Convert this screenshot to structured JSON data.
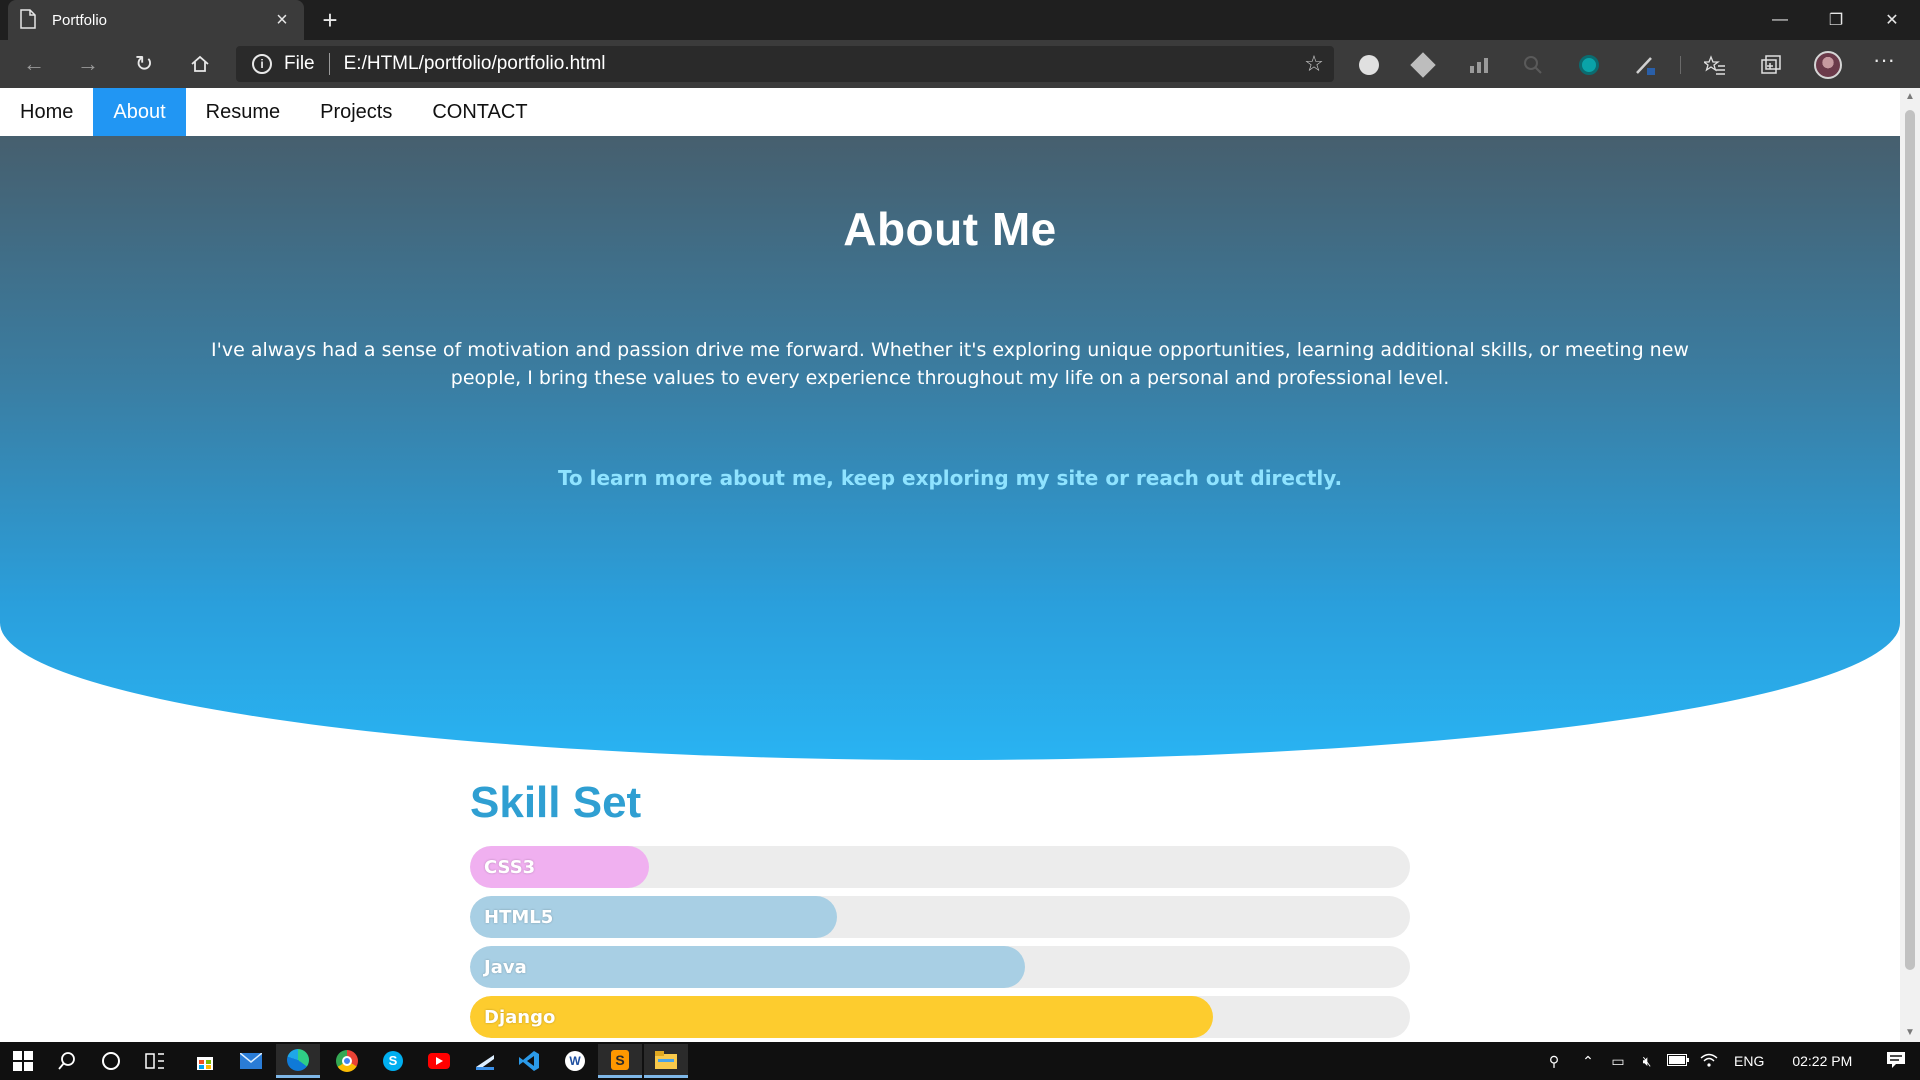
{
  "browser": {
    "tab_title": "Portfolio",
    "file_label": "File",
    "url": "E:/HTML/portfolio/portfolio.html",
    "icons": {
      "back": "back-arrow-icon",
      "forward": "forward-arrow-icon",
      "refresh": "refresh-icon",
      "home": "home-icon",
      "star": "star-icon"
    }
  },
  "site_nav": {
    "items": [
      {
        "label": "Home"
      },
      {
        "label": "About"
      },
      {
        "label": "Resume"
      },
      {
        "label": "Projects"
      },
      {
        "label": "CONTACT"
      }
    ],
    "active": "About",
    "active_color": "#2196f3"
  },
  "hero": {
    "title": "About Me",
    "bio": "I've always had a sense of motivation and passion drive me forward. Whether it's exploring unique opportunities, learning additional skills, or meeting new people, I bring these values to every experience throughout my life on a personal and professional level.",
    "cta": "To learn more about me, keep exploring my site or reach out directly.",
    "gradient_top": "#465f6e",
    "gradient_bottom": "#29b3f2"
  },
  "skills": {
    "title": "Skill Set",
    "items": [
      {
        "name": "CSS3",
        "level": 0.19,
        "color": "#f0b0f0"
      },
      {
        "name": "HTML5",
        "level": 0.39,
        "color": "#a8cfe4"
      },
      {
        "name": "Java",
        "level": 0.59,
        "color": "#a8cfe4"
      },
      {
        "name": "Django",
        "level": 0.79,
        "color": "#fdcc2e"
      }
    ]
  },
  "taskbar": {
    "language": "ENG",
    "time": "02:22 PM"
  }
}
